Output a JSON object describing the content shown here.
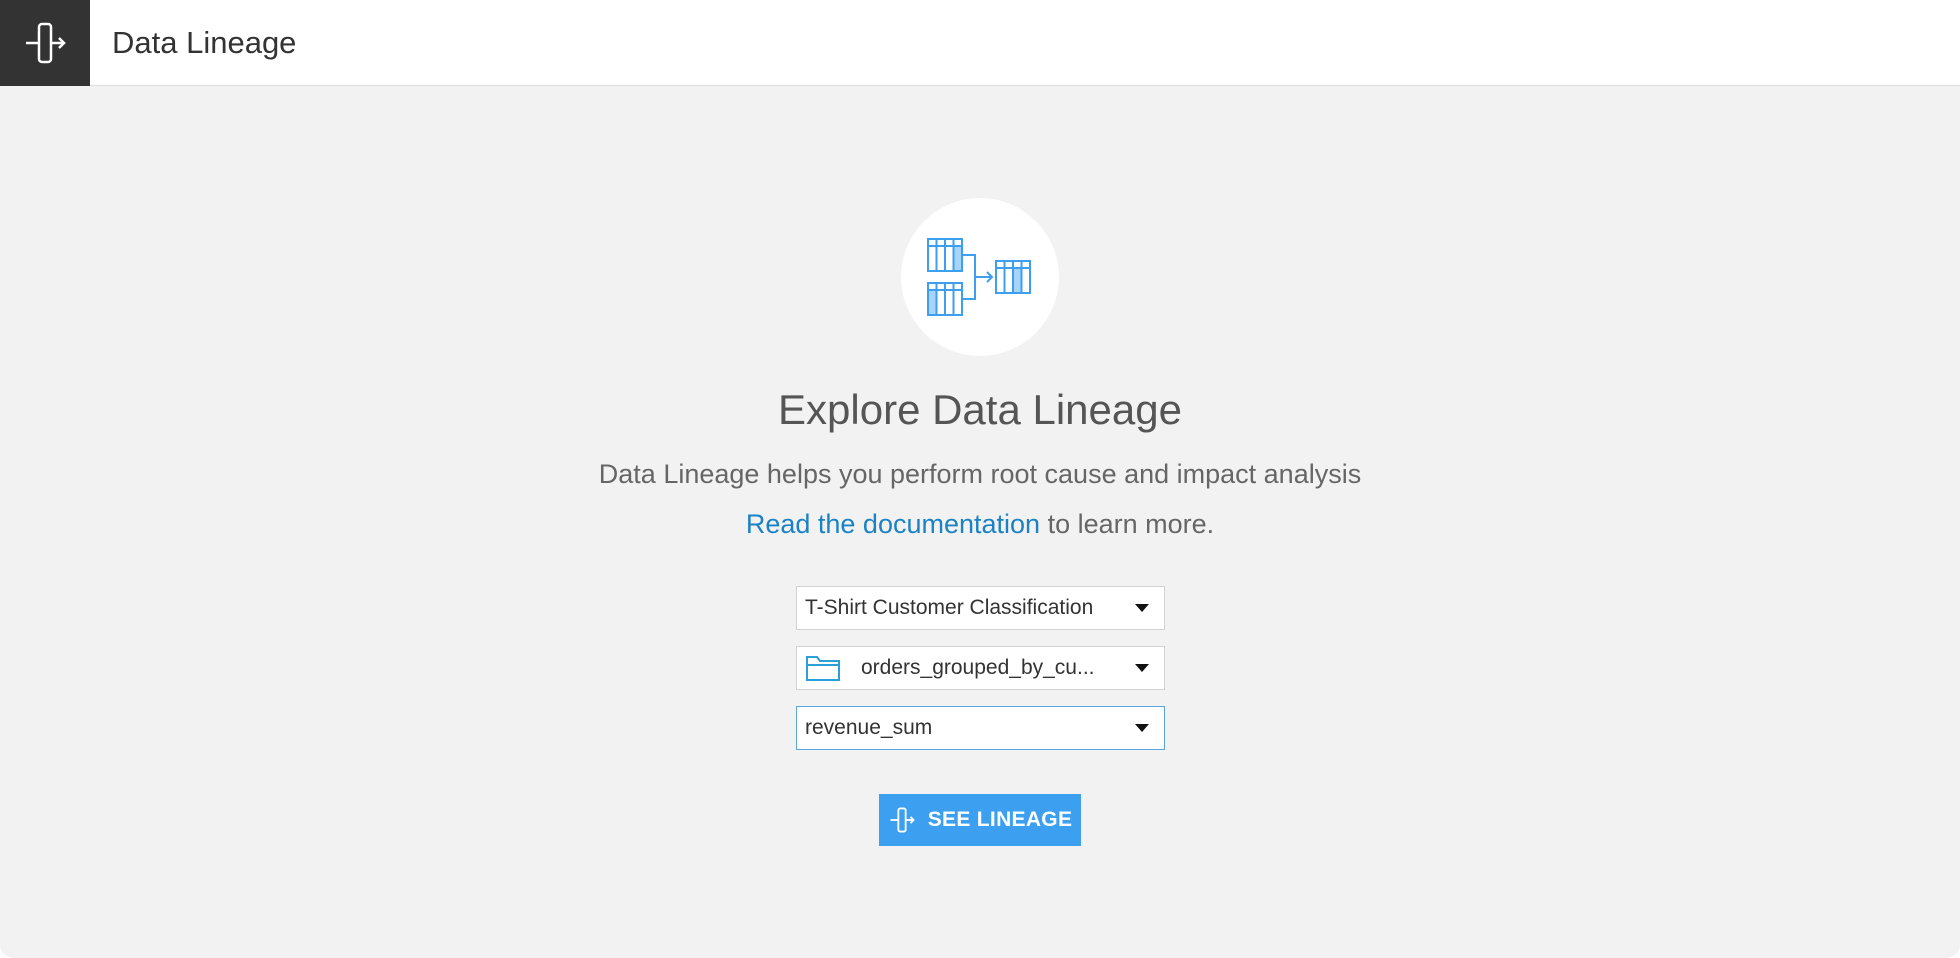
{
  "header": {
    "title": "Data Lineage",
    "icon": "lineage-icon"
  },
  "hero": {
    "icon": "data-lineage-illustration-icon",
    "title": "Explore Data Lineage",
    "subtitle": "Data Lineage helps you perform root cause and impact analysis",
    "doc_link": "Read the documentation",
    "doc_suffix": " to learn more."
  },
  "selectors": {
    "project": "T-Shirt Customer Classification",
    "dataset": "orders_grouped_by_cu...",
    "column": "revenue_sum"
  },
  "button": {
    "label": "SEE LINEAGE",
    "icon": "lineage-icon"
  },
  "colors": {
    "accent": "#3c9ff0",
    "link": "#1b82c5",
    "header_icon_bg": "#333333",
    "background": "#f2f2f2"
  }
}
